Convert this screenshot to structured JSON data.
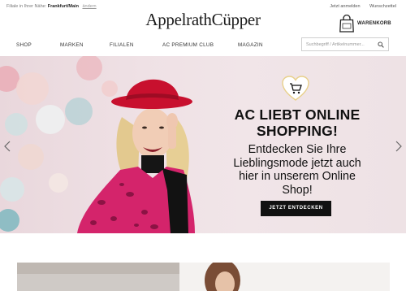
{
  "topbar": {
    "store_prefix": "Filiale in Ihrer Nähe:",
    "store_city": "Frankfurt/Main",
    "store_change": "ändern",
    "login": "Jetzt anmelden",
    "wishlist": "Wunschzettel"
  },
  "brand": {
    "logo": "AppelrathCüpper"
  },
  "cart": {
    "label": "WARENKORB",
    "icon": "shopping-bag-icon"
  },
  "nav": {
    "items": [
      {
        "label": "SHOP"
      },
      {
        "label": "MARKEN"
      },
      {
        "label": "FILIALEN"
      },
      {
        "label": "AC PREMIUM CLUB"
      },
      {
        "label": "MAGAZIN"
      }
    ]
  },
  "search": {
    "placeholder": "Suchbegriff / Artikelnummer...",
    "icon": "search-icon"
  },
  "hero": {
    "title_line1": "AC LIEBT ONLINE",
    "title_line2": "SHOPPING!",
    "text_line1": "Entdecken Sie Ihre",
    "text_line2": "Lieblingsmode jetzt auch",
    "text_line3": "hier in unserem Online",
    "text_line4": "Shop!",
    "cta": "JETZT ENTDECKEN",
    "badge_icon": "heart-cart-icon"
  },
  "colors": {
    "hat_red": "#c8102e",
    "coat_pink": "#d4246b",
    "cta_bg": "#111111"
  }
}
